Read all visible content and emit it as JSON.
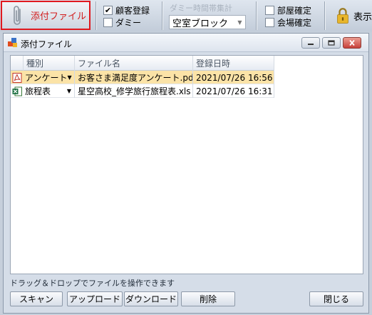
{
  "ribbon": {
    "attach_label": "添付ファイル",
    "customer_reg_label": "顧客登録",
    "customer_reg_checked": true,
    "dummy_check_label": "ダミー",
    "dummy_check_checked": false,
    "dummy_group_title": "ダミー時間帯集計",
    "room_block_value": "空室ブロック",
    "room_confirm_label": "部屋確定",
    "venue_confirm_label": "会場確定",
    "lock_label": "表示"
  },
  "window": {
    "title": "添付ファイル",
    "columns": [
      "種別",
      "ファイル名",
      "登録日時"
    ],
    "rows": [
      {
        "type": "アンケート",
        "file_icon": "pdf-icon",
        "filename": "お客さま満足度アンケート.pdf",
        "registered": "2021/07/26 16:56",
        "selected": true
      },
      {
        "type": "旅程表",
        "file_icon": "excel-icon",
        "filename": "星空高校_修学旅行旅程表.xls",
        "registered": "2021/07/26 16:31",
        "selected": false
      }
    ],
    "hint": "ドラッグ＆ドロップでファイルを操作できます",
    "buttons": {
      "scan": "スキャン",
      "upload": "アップロード",
      "download": "ダウンロード",
      "delete": "削除",
      "close": "閉じる"
    }
  },
  "colors": {
    "accent_border": "#e0191f",
    "attach_text": "#d21d1d",
    "selected_row": "#fbe3a7"
  }
}
